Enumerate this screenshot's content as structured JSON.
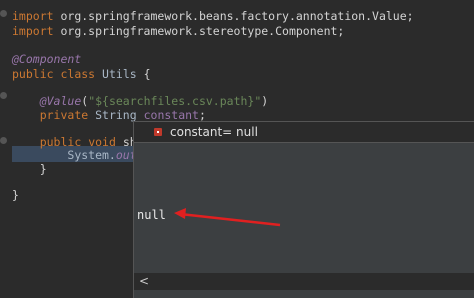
{
  "code": {
    "line1": {
      "kw": "import",
      "rest": " org.springframework.beans.factory.annotation.Value;"
    },
    "line2": {
      "kw": "import",
      "rest": " org.springframework.stereotype.Component;"
    },
    "line3": {
      "ann": "@Component"
    },
    "line4": {
      "kw1": "public",
      "kw2": "class",
      "name": "Utils",
      "brace": "{"
    },
    "line5": {
      "ann": "@Value",
      "paren_open": "(",
      "str": "\"${searchfiles.csv.path}\"",
      "paren_close": ")"
    },
    "line6": {
      "kw": "private",
      "type": "String",
      "field": "constant",
      "semi": ";"
    },
    "line7": {
      "kw1": "public",
      "kw2": "void",
      "name_partial": "sho"
    },
    "line8": {
      "cls": "System.",
      "field": "out",
      "dot": "."
    },
    "line9": {
      "brace": "}"
    },
    "line10": {
      "brace": "}"
    }
  },
  "popup": {
    "variable_label": "constant= null",
    "value": "null",
    "scroll_left": "<"
  },
  "colors": {
    "arrow": "#e02020",
    "keyword": "#cc7832",
    "annotation": "#9876aa",
    "string": "#6a8759"
  },
  "icons": {
    "variable": "private-field-icon"
  }
}
